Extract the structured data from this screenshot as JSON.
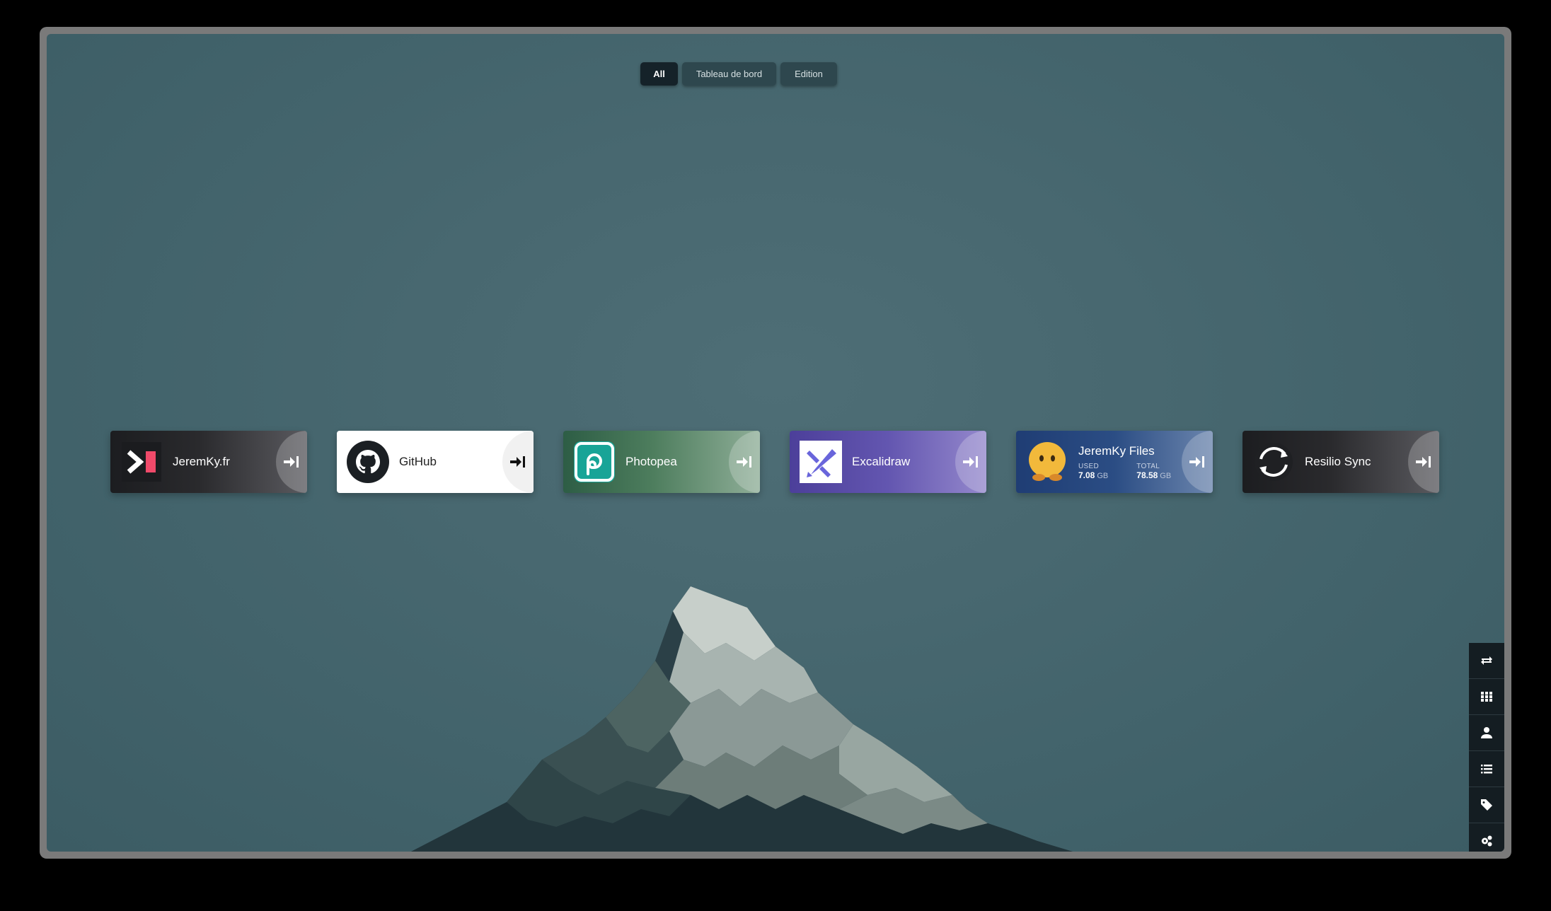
{
  "tags": [
    {
      "label": "All",
      "active": true
    },
    {
      "label": "Tableau de bord",
      "active": false
    },
    {
      "label": "Edition",
      "active": false
    }
  ],
  "cards": [
    {
      "name": "JeremKy.fr",
      "icon": "terminal-logo-icon"
    },
    {
      "name": "GitHub",
      "icon": "github-logo-icon"
    },
    {
      "name": "Photopea",
      "icon": "photopea-logo-icon"
    },
    {
      "name": "Excalidraw",
      "icon": "excalidraw-logo-icon"
    },
    {
      "name": "JeremKy Files",
      "icon": "files-face-logo-icon",
      "stats": {
        "used_label": "USED",
        "used_value": "7.08",
        "used_unit": "GB",
        "total_label": "TOTAL",
        "total_value": "78.58",
        "total_unit": "GB"
      }
    },
    {
      "name": "Resilio Sync",
      "icon": "resilio-sync-logo-icon"
    }
  ],
  "sidebar": [
    {
      "name": "switch-icon"
    },
    {
      "name": "grid-icon"
    },
    {
      "name": "user-icon"
    },
    {
      "name": "list-icon"
    },
    {
      "name": "tag-icon"
    },
    {
      "name": "settings-icon"
    }
  ],
  "colors": {
    "background": "#486870",
    "tag_active": "#152229",
    "tag_inactive": "#2e474e",
    "sidebar": "#141d22"
  }
}
